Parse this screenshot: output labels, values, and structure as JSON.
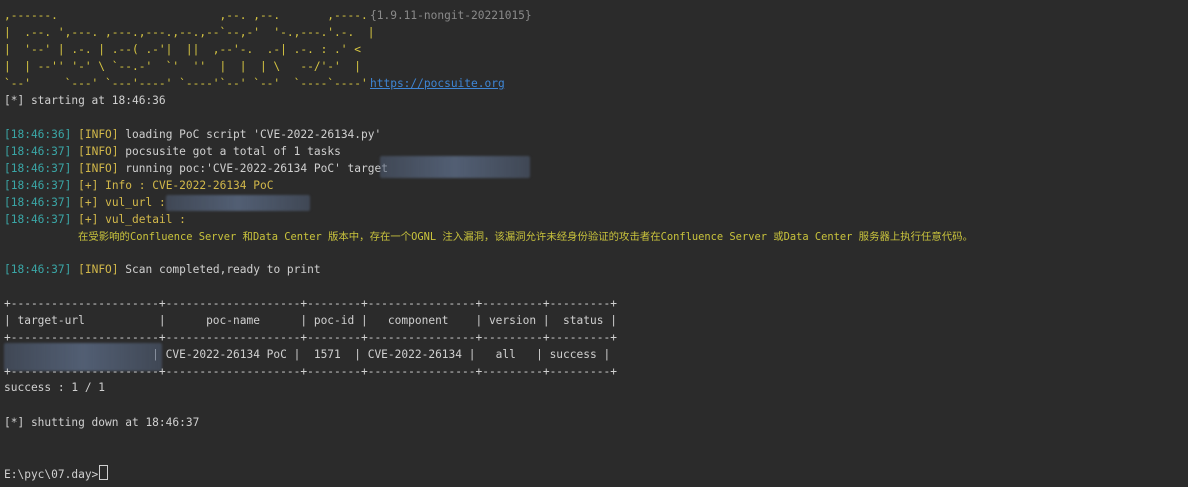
{
  "banner": {
    "lines": [
      ",------.                        ,--. ,--.       ,----.",
      "|  .--. ',---. ,---.,---.,--.,--`--,-'  '-.,---.'.-.  |",
      "|  '--' | .-. | .--( .-'|  ||  ,--'-.  .-| .-. : .' <",
      "|  | --'' '-' \\ `--.-'  `'  ''  |  |  | \\   --/'-'  |",
      "`--'     `---' `---'----' `----'`--' `--'  `----`----'"
    ],
    "version": "{1.9.11-nongit-20221015}",
    "url": "https://pocsuite.org"
  },
  "log": {
    "starting": "[*] starting at 18:46:36",
    "entries": [
      {
        "ts": "[18:46:36]",
        "tag": "[INFO]",
        "msg": "loading PoC script 'CVE-2022-26134.py'"
      },
      {
        "ts": "[18:46:37]",
        "tag": "[INFO]",
        "msg": "pocsusite got a total of 1 tasks"
      },
      {
        "ts": "[18:46:37]",
        "tag": "[INFO]",
        "msg": "running poc:'CVE-2022-26134 PoC' target"
      },
      {
        "ts": "[18:46:37]",
        "tag": "[+]",
        "msg": "Info : CVE-2022-26134 PoC"
      },
      {
        "ts": "[18:46:37]",
        "tag": "[+]",
        "msg": "vul_url :"
      },
      {
        "ts": "[18:46:37]",
        "tag": "[+]",
        "msg": "vul_detail :"
      }
    ],
    "detail_text": "在受影响的Confluence Server 和Data Center 版本中，存在一个OGNL 注入漏洞，该漏洞允许未经身份验证的攻击者在Confluence Server 或Data Center 服务器上执行任意代码。",
    "scan_done": {
      "ts": "[18:46:37]",
      "tag": "[INFO]",
      "msg": "Scan completed,ready to print"
    }
  },
  "table": {
    "border": "+----------------------+--------------------+--------+----------------+---------+---------+",
    "header": "| target-url           |      poc-name      | poc-id |   component    | version |  status |",
    "row": "                      | CVE-2022-26134 PoC |  1571  | CVE-2022-26134 |   all   | success |"
  },
  "summary": "success : 1 / 1",
  "shutdown": "[*] shutting down at 18:46:37",
  "prompt": "E:\\pyc\\07.day>"
}
